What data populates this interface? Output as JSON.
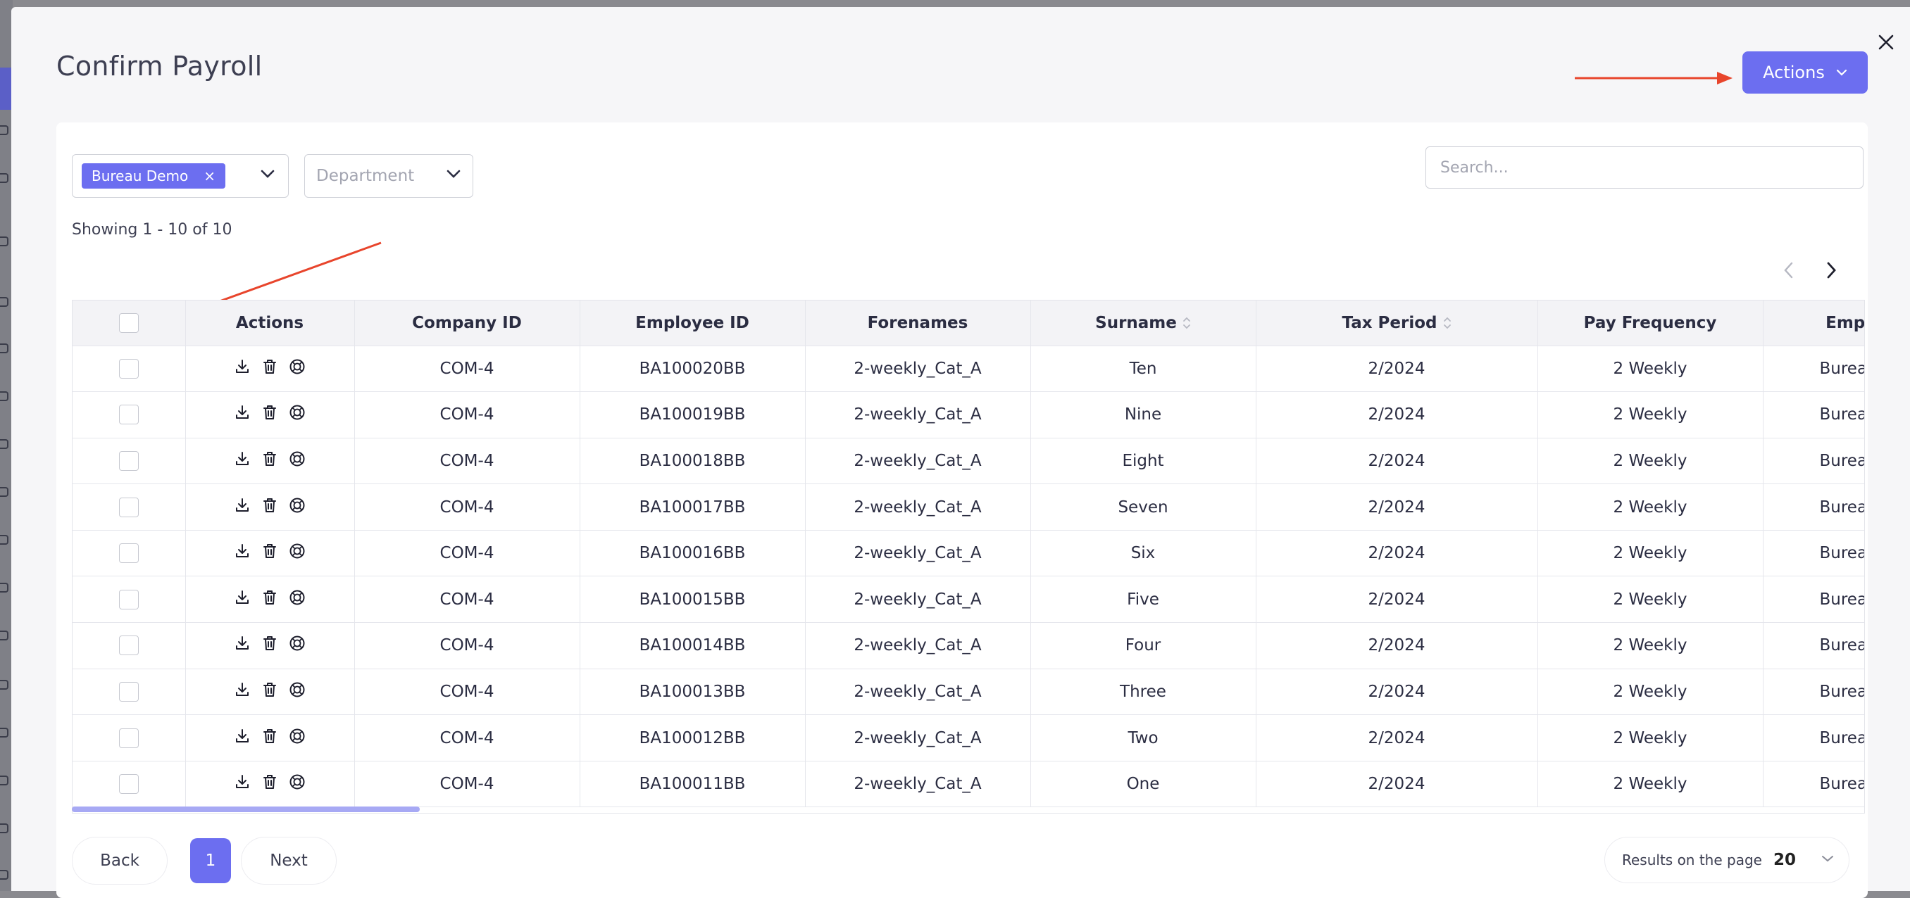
{
  "modal": {
    "title": "Confirm Payroll",
    "actions_label": "Actions"
  },
  "filters": {
    "company_chip": "Bureau Demo",
    "chip_remove": "×",
    "department_placeholder": "Department",
    "search_placeholder": "Search..."
  },
  "summary": "Showing 1 - 10 of 10",
  "table": {
    "headers": [
      "",
      "Actions",
      "Company ID",
      "Employee ID",
      "Forenames",
      "Surname",
      "Tax Period",
      "Pay Frequency",
      "Employer"
    ],
    "rows": [
      {
        "company_id": "COM-4",
        "employee_id": "BA100020BB",
        "forenames": "2-weekly_Cat_A",
        "surname": "Ten",
        "tax_period": "2/2024",
        "pay_frequency": "2 Weekly",
        "employer": "Bureau Demo"
      },
      {
        "company_id": "COM-4",
        "employee_id": "BA100019BB",
        "forenames": "2-weekly_Cat_A",
        "surname": "Nine",
        "tax_period": "2/2024",
        "pay_frequency": "2 Weekly",
        "employer": "Bureau Demo"
      },
      {
        "company_id": "COM-4",
        "employee_id": "BA100018BB",
        "forenames": "2-weekly_Cat_A",
        "surname": "Eight",
        "tax_period": "2/2024",
        "pay_frequency": "2 Weekly",
        "employer": "Bureau Demo"
      },
      {
        "company_id": "COM-4",
        "employee_id": "BA100017BB",
        "forenames": "2-weekly_Cat_A",
        "surname": "Seven",
        "tax_period": "2/2024",
        "pay_frequency": "2 Weekly",
        "employer": "Bureau Demo"
      },
      {
        "company_id": "COM-4",
        "employee_id": "BA100016BB",
        "forenames": "2-weekly_Cat_A",
        "surname": "Six",
        "tax_period": "2/2024",
        "pay_frequency": "2 Weekly",
        "employer": "Bureau Demo"
      },
      {
        "company_id": "COM-4",
        "employee_id": "BA100015BB",
        "forenames": "2-weekly_Cat_A",
        "surname": "Five",
        "tax_period": "2/2024",
        "pay_frequency": "2 Weekly",
        "employer": "Bureau Demo"
      },
      {
        "company_id": "COM-4",
        "employee_id": "BA100014BB",
        "forenames": "2-weekly_Cat_A",
        "surname": "Four",
        "tax_period": "2/2024",
        "pay_frequency": "2 Weekly",
        "employer": "Bureau Demo"
      },
      {
        "company_id": "COM-4",
        "employee_id": "BA100013BB",
        "forenames": "2-weekly_Cat_A",
        "surname": "Three",
        "tax_period": "2/2024",
        "pay_frequency": "2 Weekly",
        "employer": "Bureau Demo"
      },
      {
        "company_id": "COM-4",
        "employee_id": "BA100012BB",
        "forenames": "2-weekly_Cat_A",
        "surname": "Two",
        "tax_period": "2/2024",
        "pay_frequency": "2 Weekly",
        "employer": "Bureau Demo"
      },
      {
        "company_id": "COM-4",
        "employee_id": "BA100011BB",
        "forenames": "2-weekly_Cat_A",
        "surname": "One",
        "tax_period": "2/2024",
        "pay_frequency": "2 Weekly",
        "employer": "Bureau Demo"
      }
    ],
    "row_action_icons": [
      "download-icon",
      "trash-icon",
      "cancel-icon"
    ],
    "sortable_columns": [
      "Surname",
      "Tax Period"
    ]
  },
  "pagination": {
    "back_label": "Back",
    "current_page": "1",
    "next_label": "Next",
    "results_label": "Results on the page",
    "results_value": "20"
  },
  "colors": {
    "accent": "#6c6ef0",
    "annotation_arrow": "#e8452c"
  }
}
